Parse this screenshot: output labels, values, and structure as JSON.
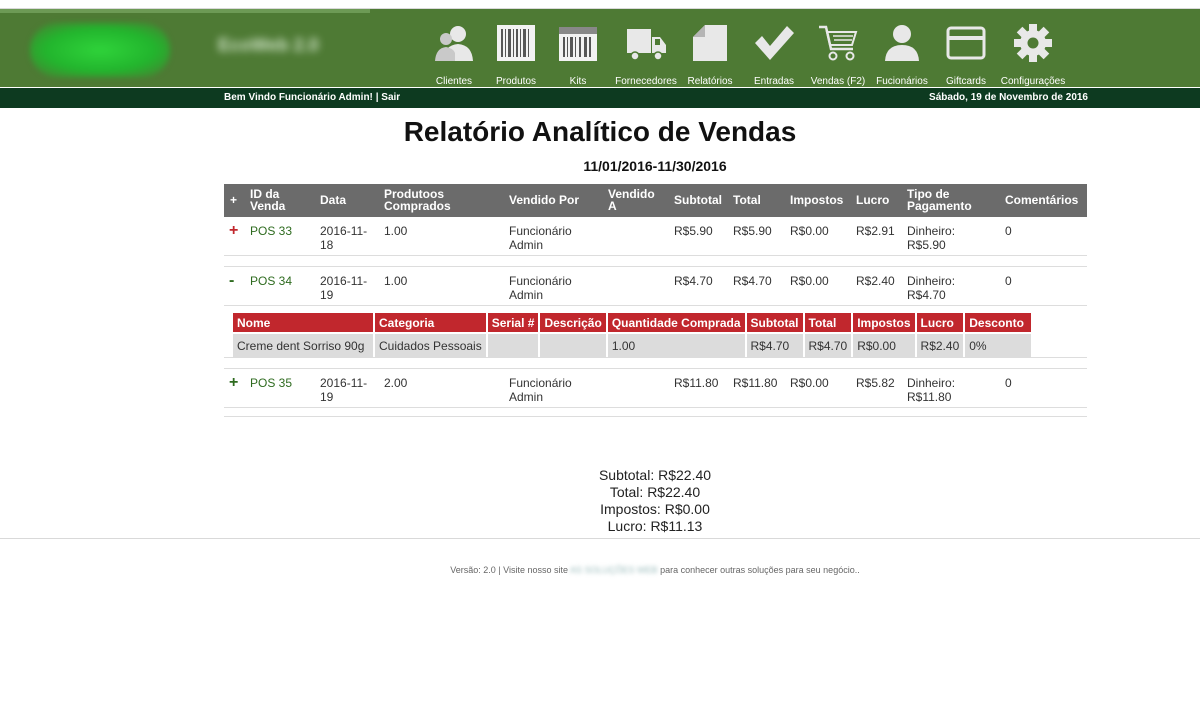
{
  "header": {
    "brand_name": "EcoWeb 2.0",
    "nav": [
      {
        "label": "Clientes",
        "icon": "users-icon"
      },
      {
        "label": "Produtos",
        "icon": "barcode-icon"
      },
      {
        "label": "Kits",
        "icon": "kit-barcode-icon"
      },
      {
        "label": "Fornecedores",
        "icon": "truck-icon"
      },
      {
        "label": "Relatórios",
        "icon": "report-icon"
      },
      {
        "label": "Entradas",
        "icon": "checkmark-icon"
      },
      {
        "label": "Vendas (F2)",
        "icon": "cart-icon"
      },
      {
        "label": "Fucionários",
        "icon": "person-icon"
      },
      {
        "label": "Giftcards",
        "icon": "card-icon"
      },
      {
        "label": "Configurações",
        "icon": "gear-icon"
      }
    ]
  },
  "welcome": {
    "text": "Bem Vindo Funcionário Admin!",
    "separator": "|",
    "logout": "Sair",
    "date": "Sábado, 19 de Novembro de 2016"
  },
  "report": {
    "title": "Relatório Analítico de Vendas",
    "date_range": "11/01/2016-11/30/2016",
    "columns": {
      "toggle": "+",
      "id": "ID da Venda",
      "date": "Data",
      "products": "Produtoos Comprados",
      "sold_by": "Vendido Por",
      "sold_to": "Vendido A",
      "subtotal": "Subtotal",
      "total": "Total",
      "taxes": "Impostos",
      "profit": "Lucro",
      "payment": "Tipo de Pagamento",
      "comments": "Comentários"
    },
    "sales": [
      {
        "toggle": "+",
        "id": "POS 33",
        "date": "2016-11-18",
        "products": "1.00",
        "sold_by": "Funcionário Admin",
        "sold_to": "",
        "subtotal": "R$5.90",
        "total": "R$5.90",
        "taxes": "R$0.00",
        "profit": "R$2.91",
        "payment": "Dinheiro: R$5.90",
        "comments": "0"
      },
      {
        "toggle": "-",
        "id": "POS 34",
        "date": "2016-11-19",
        "products": "1.00",
        "sold_by": "Funcionário Admin",
        "sold_to": "",
        "subtotal": "R$4.70",
        "total": "R$4.70",
        "taxes": "R$0.00",
        "profit": "R$2.40",
        "payment": "Dinheiro: R$4.70",
        "comments": "0"
      },
      {
        "toggle": "+",
        "id": "POS 35",
        "date": "2016-11-19",
        "products": "2.00",
        "sold_by": "Funcionário Admin",
        "sold_to": "",
        "subtotal": "R$11.80",
        "total": "R$11.80",
        "taxes": "R$0.00",
        "profit": "R$5.82",
        "payment": "Dinheiro: R$11.80",
        "comments": "0"
      }
    ],
    "detail": {
      "columns": [
        "Nome",
        "Categoria",
        "Serial #",
        "Descrição",
        "Quantidade Comprada",
        "Subtotal",
        "Total",
        "Impostos",
        "Lucro",
        "Desconto"
      ],
      "rows": [
        [
          "Creme dent Sorriso 90g",
          "Cuidados Pessoais",
          "",
          "",
          "1.00",
          "R$4.70",
          "R$4.70",
          "R$0.00",
          "R$2.40",
          "0%"
        ]
      ]
    }
  },
  "summary": {
    "subtotal": "Subtotal: R$22.40",
    "total": "Total: R$22.40",
    "taxes": "Impostos: R$0.00",
    "profit": "Lucro: R$11.13"
  },
  "footer": {
    "version": "Versão: 2.0 | Visite nosso site",
    "site": "AS SOLUÇÕES WEB",
    "tail": "para conhecer outras soluções para seu negócio.."
  },
  "colors": {
    "header_green": "#4e7a34",
    "welcome_bar": "#0d3a20",
    "table_header": "#6b6b6b",
    "detail_header": "#c1272d",
    "sale_id": "#2e6b1f"
  }
}
